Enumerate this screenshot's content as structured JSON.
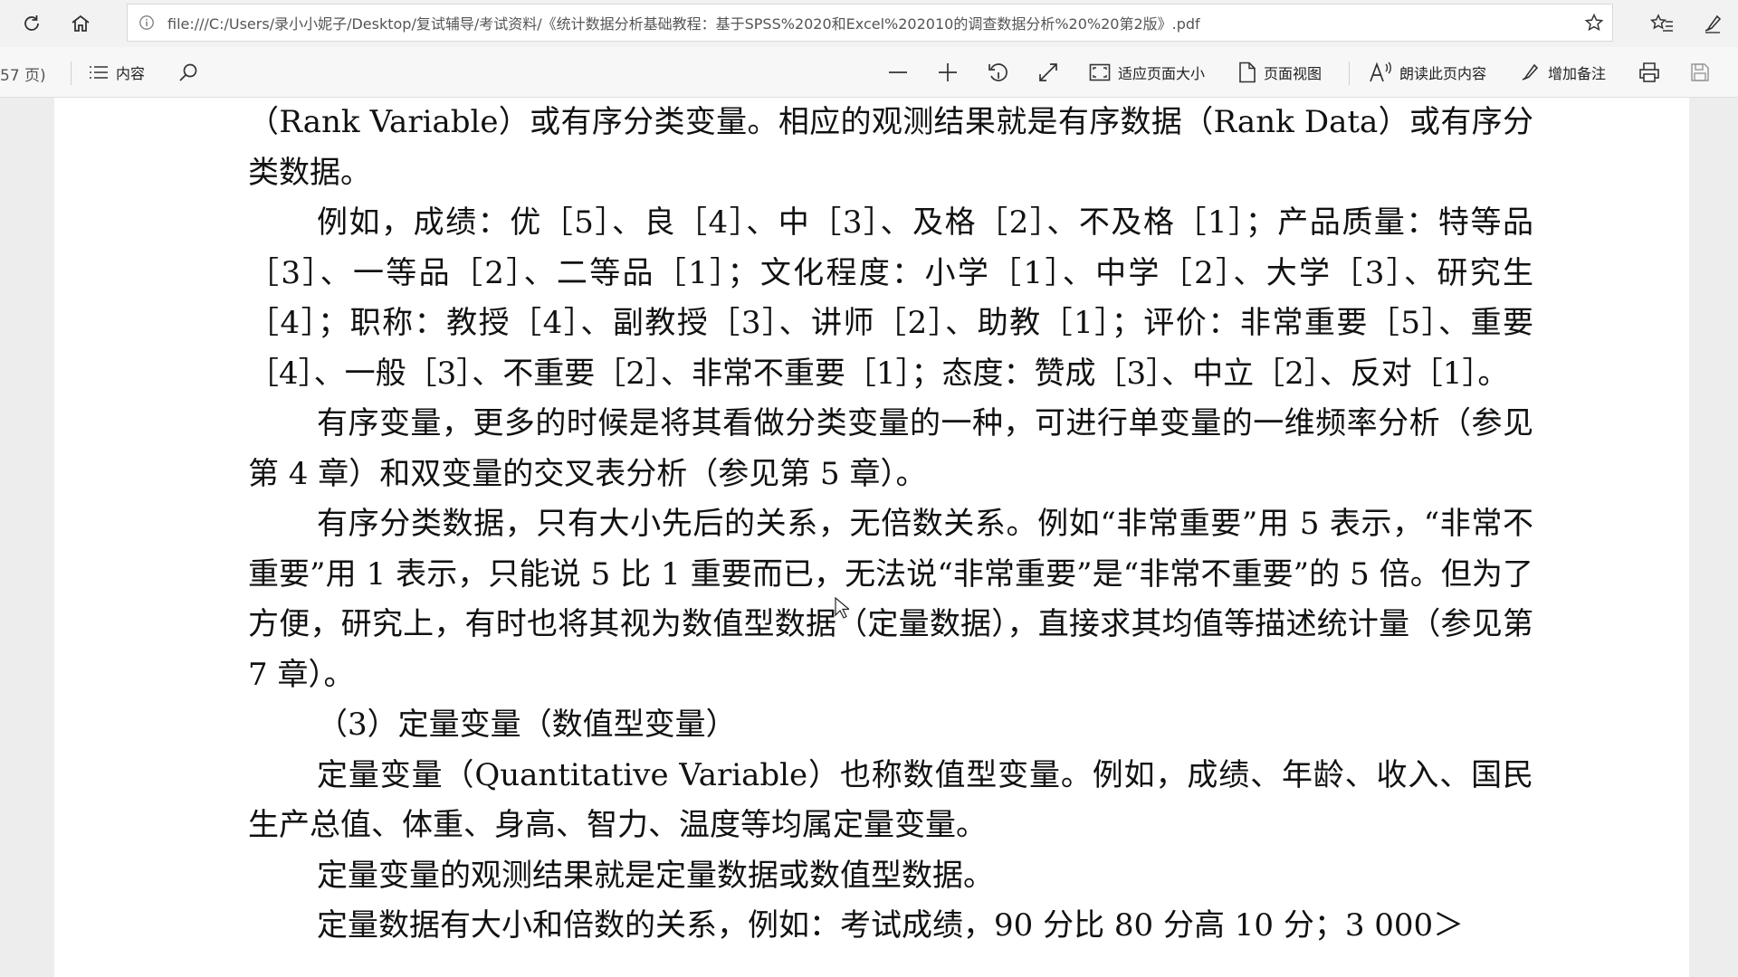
{
  "browser": {
    "url": "file:///C:/Users/录小小妮子/Desktop/复试辅导/考试资料/《统计数据分析基础教程：基于SPSS%2020和Excel%202010的调查数据分析%20%20第2版》.pdf"
  },
  "toolbar": {
    "page_count": "57 页)",
    "contents": "内容",
    "fit_page": "适应页面大小",
    "page_view": "页面视图",
    "read_aloud": "朗读此页内容",
    "add_notes": "增加备注"
  },
  "document": {
    "paragraphs": [
      "（Rank Variable）或有序分类变量。相应的观测结果就是有序数据（Rank Data）或有序分类数据。",
      "例如，成绩：优［5］、良［4］、中［3］、及格［2］、不及格［1］；产品质量：特等品［3］、一等品［2］、二等品［1］；文化程度：小学［1］、中学［2］、大学［3］、研究生［4］；职称：教授［4］、副教授［3］、讲师［2］、助教［1］；评价：非常重要［5］、重要［4］、一般［3］、不重要［2］、非常不重要［1］；态度：赞成［3］、中立［2］、反对［1］。",
      "有序变量，更多的时候是将其看做分类变量的一种，可进行单变量的一维频率分析（参见第 4 章）和双变量的交叉表分析（参见第 5 章）。",
      "有序分类数据，只有大小先后的关系，无倍数关系。例如“非常重要”用 5 表示，“非常不重要”用 1 表示，只能说 5 比 1 重要而已，无法说“非常重要”是“非常不重要”的 5 倍。但为了方便，研究上，有时也将其视为数值型数据（定量数据），直接求其均值等描述统计量（参见第 7 章）。",
      "（3）定量变量（数值型变量）",
      "定量变量（Quantitative Variable）也称数值型变量。例如，成绩、年龄、收入、国民生产总值、体重、身高、智力、温度等均属定量变量。",
      "定量变量的观测结果就是定量数据或数值型数据。",
      "定量数据有大小和倍数的关系，例如：考试成绩，90 分比 80 分高 10 分；3 000＞"
    ]
  },
  "icons": {
    "refresh": "refresh-icon",
    "home": "home-icon",
    "info": "info-icon",
    "favorite": "star-icon",
    "favorites_list": "favorites-icon",
    "pen": "pen-icon",
    "contents": "list-icon",
    "search": "search-icon",
    "zoom_out": "minus-icon",
    "zoom_in": "plus-icon",
    "rotate": "rotate-icon",
    "fullscreen": "expand-icon",
    "fit": "fit-page-icon",
    "page_view": "page-icon",
    "read_aloud": "read-aloud-icon",
    "notes": "pen-icon",
    "print": "print-icon",
    "save": "save-icon"
  }
}
